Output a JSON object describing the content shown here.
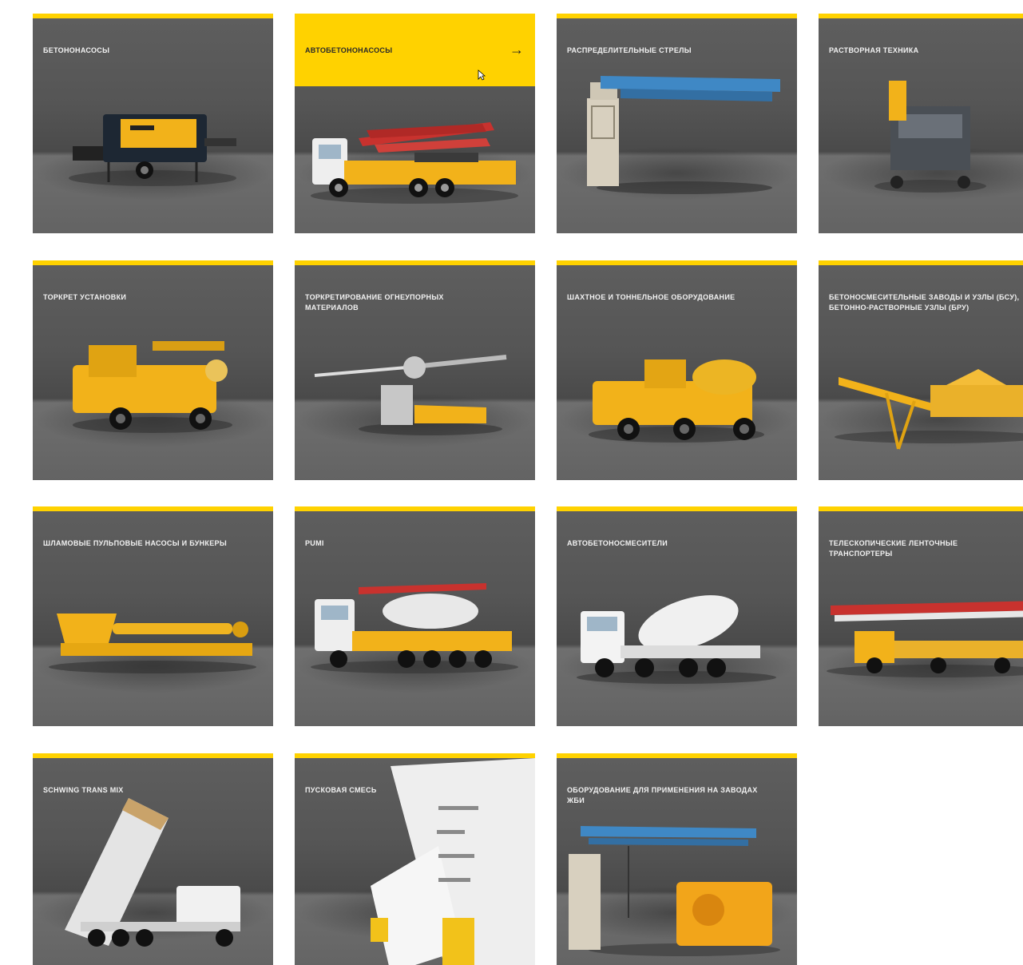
{
  "catalog": {
    "items": [
      {
        "title": "БЕТОНОНАСОСЫ",
        "icon": "stationary-concrete-pump-image"
      },
      {
        "title": "АВТОБЕТОНОНАСОСЫ",
        "icon": "truck-mounted-concrete-pump-image",
        "arrow": "→"
      },
      {
        "title": "РАСПРЕДЕЛИТЕЛЬНЫЕ СТРЕЛЫ",
        "icon": "placing-boom-image"
      },
      {
        "title": "РАСТВОРНАЯ ТЕХНИКА",
        "icon": "mortar-machine-image"
      },
      {
        "title": "ТОРКРЕТ УСТАНОВКИ",
        "icon": "shotcrete-machine-image"
      },
      {
        "title": "ТОРКРЕТИРОВАНИЕ ОГНЕУПОРНЫХ МАТЕРИАЛОВ",
        "icon": "refractory-gunning-machine-image"
      },
      {
        "title": "ШАХТНОЕ И ТОННЕЛЬНОЕ ОБОРУДОВАНИЕ",
        "icon": "tunnel-mixer-image"
      },
      {
        "title": "БЕТОНОСМЕСИТЕЛЬНЫЕ ЗАВОДЫ И УЗЛЫ (БСУ), БЕТОННО-РАСТВОРНЫЕ УЗЛЫ (БРУ)",
        "icon": "batching-plant-image"
      },
      {
        "title": "ШЛАМОВЫЕ ПУЛЬПОВЫЕ НАСОСЫ И БУНКЕРЫ",
        "icon": "slurry-pump-image"
      },
      {
        "title": "PUMI",
        "icon": "pumi-truck-image"
      },
      {
        "title": "АВТОБЕТОНОСМЕСИТЕЛИ",
        "icon": "truck-mixer-image"
      },
      {
        "title": "ТЕЛЕСКОПИЧЕСКИЕ ЛЕНТОЧНЫЕ ТРАНСПОРТЕРЫ",
        "icon": "telescopic-belt-conveyor-image"
      },
      {
        "title": "SCHWING TRANS MIX",
        "icon": "trans-mix-tipper-image"
      },
      {
        "title": "ПУСКОВАЯ СМЕСЬ",
        "icon": "starter-mix-bags-image"
      },
      {
        "title": "ОБОРУДОВАНИЕ ДЛЯ ПРИМЕНЕНИЯ НА ЗАВОДАХ ЖБИ",
        "icon": "precast-plant-equipment-image"
      }
    ]
  },
  "colors": {
    "accent": "#ffd200",
    "card_bg": "#585858",
    "machine_yellow": "#f2b21a",
    "boom_blue": "#3f88c5",
    "boom_red": "#c8322e"
  }
}
